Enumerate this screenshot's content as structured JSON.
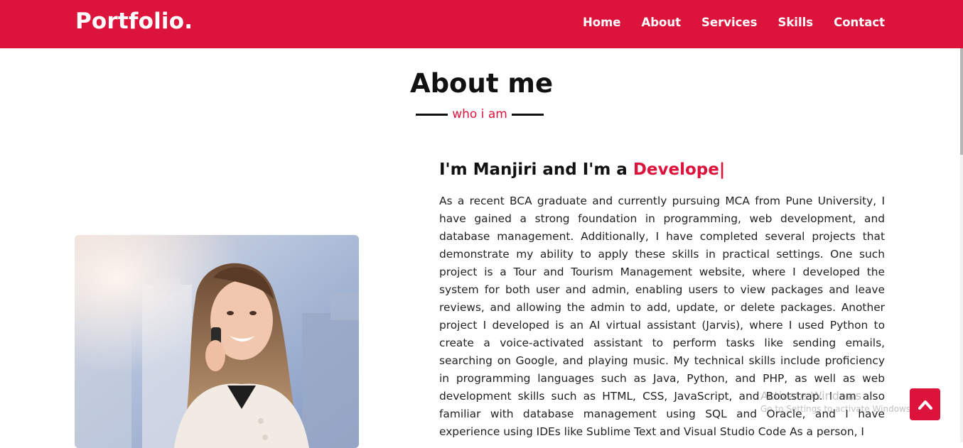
{
  "navbar": {
    "logo": "Portfolio.",
    "links": [
      "Home",
      "About",
      "Services",
      "Skills",
      "Contact"
    ]
  },
  "about": {
    "title": "About me",
    "subtitle": "who i am",
    "intro_prefix": "I'm Manjiri and I'm a ",
    "intro_typed": "Develope|",
    "bio": "As a recent BCA graduate and currently pursuing MCA from Pune University, I have gained a strong foundation in programming, web development, and database management. Additionally, I have completed several projects that demonstrate my ability to apply these skills in practical settings. One such project is a Tour and Tourism Management website, where I developed the system for both user and admin, enabling users to view packages and leave reviews, and allowing the admin to add, update, or delete packages. Another project I developed is an AI virtual assistant (Jarvis), where I used Python to create a voice-activated assistant to perform tasks like sending emails, searching on Google, and playing music. My technical skills include proficiency in programming languages such as Java, Python, and PHP, as well as web development skills such as HTML, CSS, JavaScript, and Bootstrap. I am also familiar with database management using SQL and Oracle, and I have experience using IDEs like Sublime Text and Visual Studio Code As a person, I"
  },
  "watermark": {
    "title": "Activate Windows",
    "subtitle": "Go to Settings to activate Windows."
  },
  "icons": {
    "scroll_top": "chevron-up-icon",
    "photo": "portrait-photo"
  },
  "colors": {
    "accent": "#dc143c",
    "text": "#111111",
    "background": "#ffffff"
  }
}
